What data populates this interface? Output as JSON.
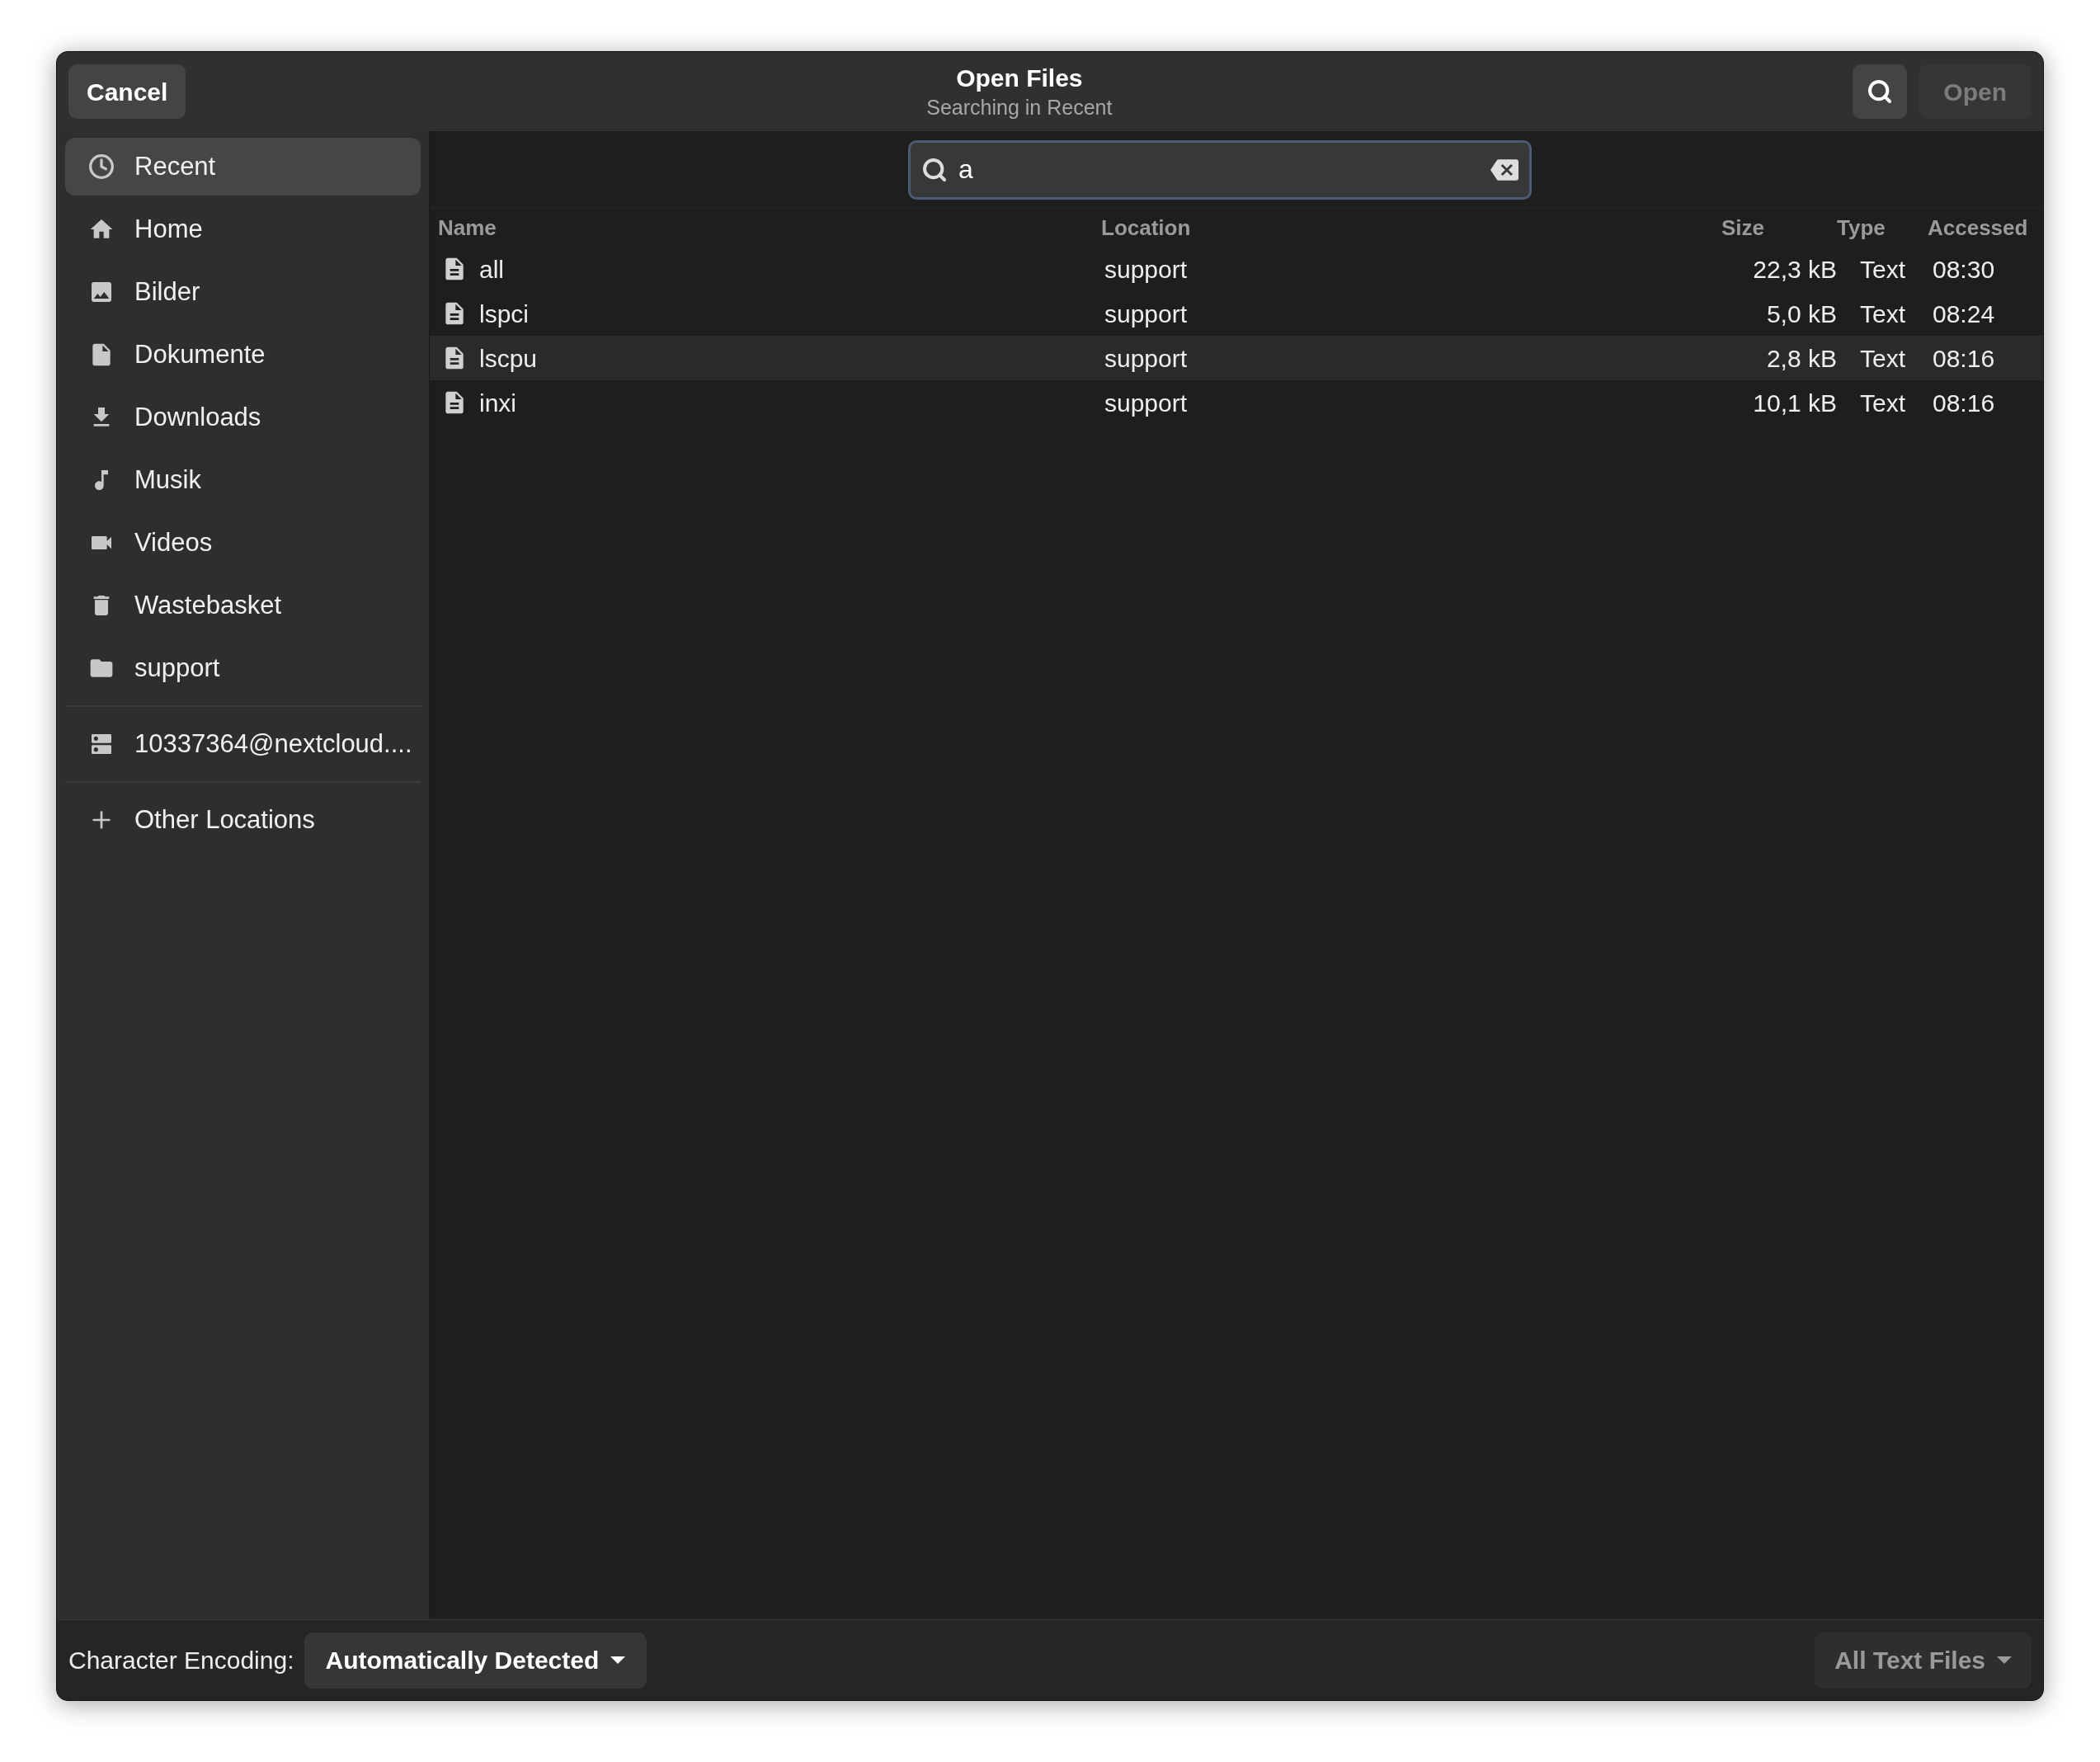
{
  "header": {
    "cancel": "Cancel",
    "title": "Open Files",
    "subtitle": "Searching in Recent",
    "open": "Open",
    "open_disabled": true
  },
  "search": {
    "value": "a"
  },
  "sidebar": {
    "groups": [
      [
        {
          "label": "Recent",
          "kind": "recent",
          "selected": true
        },
        {
          "label": "Home",
          "kind": "home",
          "selected": false
        },
        {
          "label": "Bilder",
          "kind": "pictures",
          "selected": false
        },
        {
          "label": "Dokumente",
          "kind": "documents",
          "selected": false
        },
        {
          "label": "Downloads",
          "kind": "downloads",
          "selected": false
        },
        {
          "label": "Musik",
          "kind": "music",
          "selected": false
        },
        {
          "label": "Videos",
          "kind": "videos",
          "selected": false
        },
        {
          "label": "Wastebasket",
          "kind": "trash",
          "selected": false
        },
        {
          "label": "support",
          "kind": "folder",
          "selected": false
        }
      ],
      [
        {
          "label": "10337364@nextcloud....",
          "kind": "server",
          "selected": false
        }
      ],
      [
        {
          "label": "Other Locations",
          "kind": "other",
          "selected": false
        }
      ]
    ]
  },
  "table": {
    "columns": [
      "Name",
      "Location",
      "Size",
      "Type",
      "Accessed"
    ],
    "rows": [
      {
        "name": "all",
        "location": "support",
        "size": "22,3 kB",
        "type": "Text",
        "accessed": "08:30",
        "selected": false
      },
      {
        "name": "lspci",
        "location": "support",
        "size": "5,0 kB",
        "type": "Text",
        "accessed": "08:24",
        "selected": false
      },
      {
        "name": "lscpu",
        "location": "support",
        "size": "2,8 kB",
        "type": "Text",
        "accessed": "08:16",
        "selected": true
      },
      {
        "name": "inxi",
        "location": "support",
        "size": "10,1 kB",
        "type": "Text",
        "accessed": "08:16",
        "selected": false
      }
    ]
  },
  "footer": {
    "encoding_label": "Character Encoding:",
    "encoding_value": "Automatically Detected",
    "filter": "All Text Files"
  }
}
